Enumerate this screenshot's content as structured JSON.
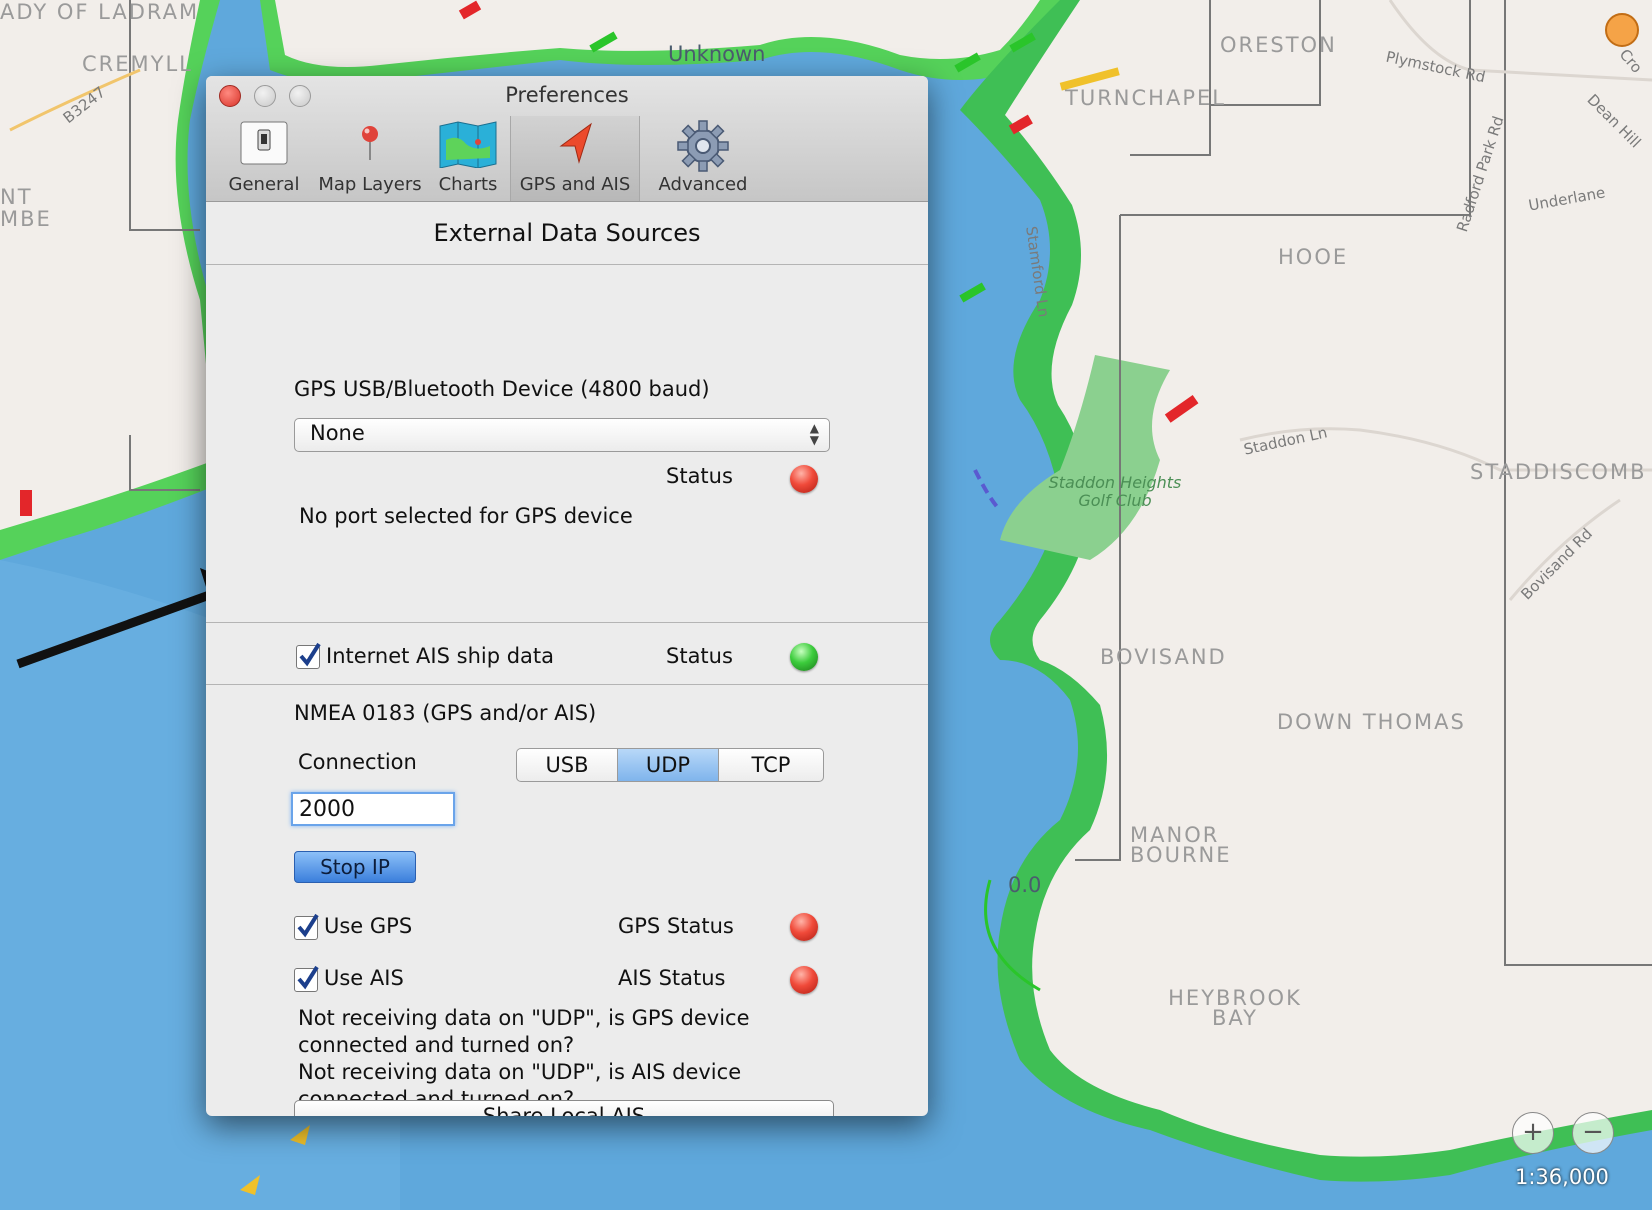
{
  "map": {
    "labels": {
      "lady_of_ladram": "ADY OF LADRAM",
      "cremyll": "CREMYLL",
      "unknown": "Unknown",
      "oreston": "ORESTON",
      "turnchapel": "TURNCHAPEL",
      "plymstock_rd": "Plymstock Rd",
      "dean_hill": "Dean Hill",
      "radford_park_rd": "Radford Park Rd",
      "underlane": "Underlane",
      "hooe": "HOOE",
      "stamford_ln": "Stamford Ln",
      "b3247": "B3247",
      "nt": "NT",
      "mbe": "MBE",
      "staddon_ln": "Staddon Ln",
      "staddon_heights_golf_club": "Staddon Heights Golf Club",
      "staddiscombe": "STADDISCOMB",
      "bovisand_rd": "Bovisand Rd",
      "bovisand": "BOVISAND",
      "down_thomas": "DOWN THOMAS",
      "manor_bourne": "MANOR BOURNE",
      "depth": "0.0",
      "heybrook_bay": "HEYBROOK BAY",
      "cro": "Cro"
    },
    "zoom_in": "+",
    "zoom_out": "−",
    "scale": "1:36,000"
  },
  "window": {
    "title": "Preferences",
    "toolbar": [
      {
        "label": "General",
        "icon": "switch-icon"
      },
      {
        "label": "Map Layers",
        "icon": "pin-icon"
      },
      {
        "label": "Charts",
        "icon": "chart-map-icon"
      },
      {
        "label": "GPS and AIS",
        "icon": "arrow-location-icon",
        "selected": true
      },
      {
        "label": "Advanced",
        "icon": "gear-icon"
      }
    ]
  },
  "content": {
    "heading": "External Data Sources",
    "gps_device_label": "GPS USB/Bluetooth Device (4800 baud)",
    "gps_device_value": "None",
    "status_label": "Status",
    "no_port_message": "No port selected for GPS device",
    "internet_ais_label": "Internet AIS ship data",
    "internet_ais_checked": true,
    "internet_ais_status_label": "Status",
    "nmea_label": "NMEA 0183 (GPS and/or AIS)",
    "connection_label": "Connection",
    "connection_options": [
      "USB",
      "UDP",
      "TCP"
    ],
    "connection_selected": "UDP",
    "port_value": "2000",
    "stop_ip_label": "Stop IP",
    "use_gps_label": "Use GPS",
    "use_gps_checked": true,
    "gps_status_label": "GPS Status",
    "use_ais_label": "Use AIS",
    "use_ais_checked": true,
    "ais_status_label": "AIS Status",
    "msg_line1": "Not receiving data on \"UDP\", is GPS device",
    "msg_line2": "connected and turned on?",
    "msg_line3": "Not receiving data on \"UDP\", is AIS device",
    "msg_line4": "connected and turned on?",
    "share_local_ais_label": "Share Local AIS"
  },
  "colors": {
    "status_off": "#e8382a",
    "status_on": "#33c133",
    "selection_blue": "#7fb4ec",
    "land_green": "#55d25a",
    "water": "#5fa8dc",
    "land": "#f2eeea"
  }
}
